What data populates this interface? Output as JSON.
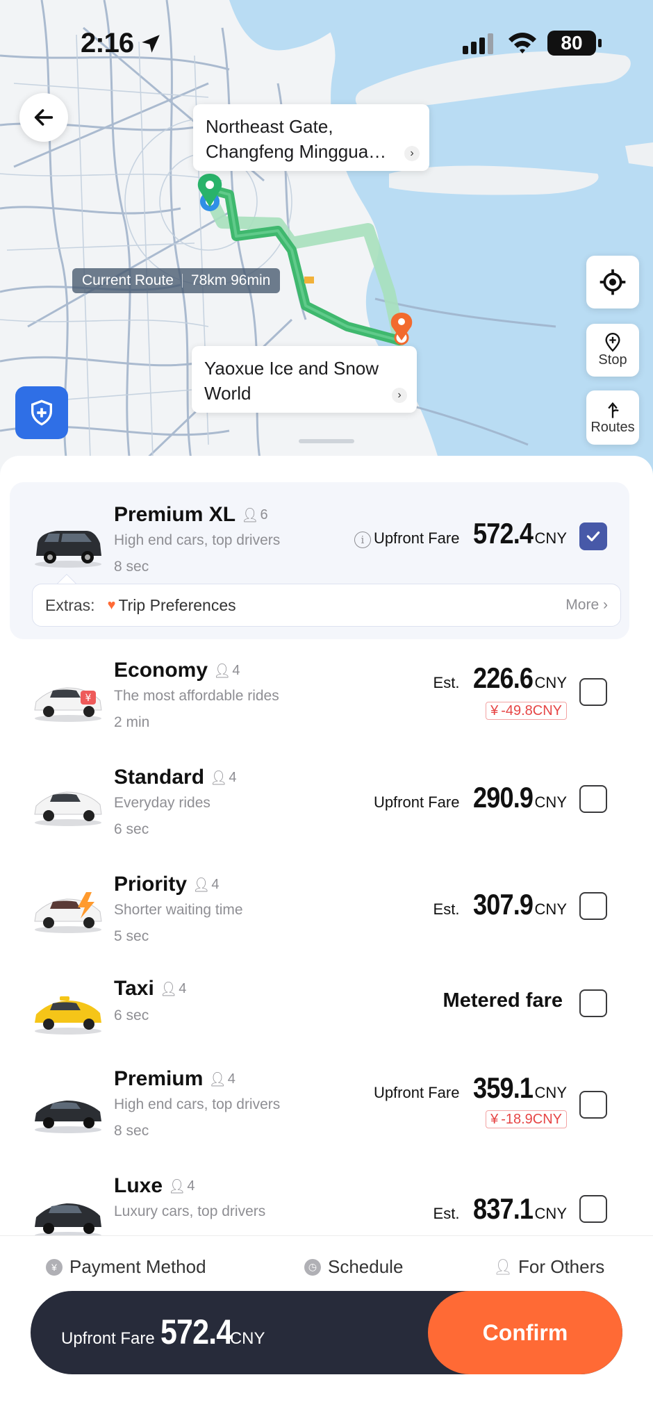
{
  "status_bar": {
    "time": "2:16",
    "battery": "80"
  },
  "map": {
    "origin_label": "Northeast Gate, Changfeng Minggua…",
    "destination_label": "Yaoxue Ice and Snow World",
    "route_pill": {
      "label": "Current Route",
      "detail": "78km 96min"
    },
    "buttons": {
      "stop": "Stop",
      "routes": "Routes"
    }
  },
  "rides": [
    {
      "name": "Premium XL",
      "seats": "6",
      "desc": "High end cars, top drivers",
      "eta": "8 sec",
      "price_prefix": "Upfront Fare",
      "price": "572.4",
      "currency": "CNY",
      "selected": true,
      "car_color": "#2b2e33"
    },
    {
      "name": "Economy",
      "seats": "4",
      "desc": "The most affordable rides",
      "eta": "2 min",
      "price_prefix": "Est.",
      "price": "226.6",
      "currency": "CNY",
      "discount": "-49.8CNY",
      "selected": false,
      "car_color": "#f4f4f4"
    },
    {
      "name": "Standard",
      "seats": "4",
      "desc": "Everyday rides",
      "eta": "6 sec",
      "price_prefix": "Upfront Fare",
      "price": "290.9",
      "currency": "CNY",
      "selected": false,
      "car_color": "#f4f4f4"
    },
    {
      "name": "Priority",
      "seats": "4",
      "desc": "Shorter waiting time",
      "eta": "5 sec",
      "price_prefix": "Est.",
      "price": "307.9",
      "currency": "CNY",
      "selected": false,
      "car_color": "#f4f4f4"
    },
    {
      "name": "Taxi",
      "seats": "4",
      "eta": "6 sec",
      "price_prefix": "Metered fare",
      "selected": false,
      "car_color": "#f5c518"
    },
    {
      "name": "Premium",
      "seats": "4",
      "desc": "High end cars, top drivers",
      "eta": "8 sec",
      "price_prefix": "Upfront Fare",
      "price": "359.1",
      "currency": "CNY",
      "discount": "-18.9CNY",
      "selected": false,
      "car_color": "#2b2e33"
    },
    {
      "name": "Luxe",
      "seats": "4",
      "desc": "Luxury cars, top drivers",
      "price_prefix": "Est.",
      "price": "837.1",
      "currency": "CNY",
      "selected": false,
      "car_color": "#2b2e33"
    }
  ],
  "extras": {
    "label": "Extras:",
    "item": "Trip Preferences",
    "more": "More"
  },
  "options": {
    "payment": "Payment Method",
    "schedule": "Schedule",
    "others": "For Others"
  },
  "cta": {
    "prefix": "Upfront Fare",
    "price": "572.4",
    "currency": "CNY",
    "confirm": "Confirm"
  },
  "colors": {
    "accent": "#ff6a35",
    "dark": "#272b3a",
    "route": "#3fb86e",
    "check": "#4759a8",
    "discount": "#e64545"
  }
}
